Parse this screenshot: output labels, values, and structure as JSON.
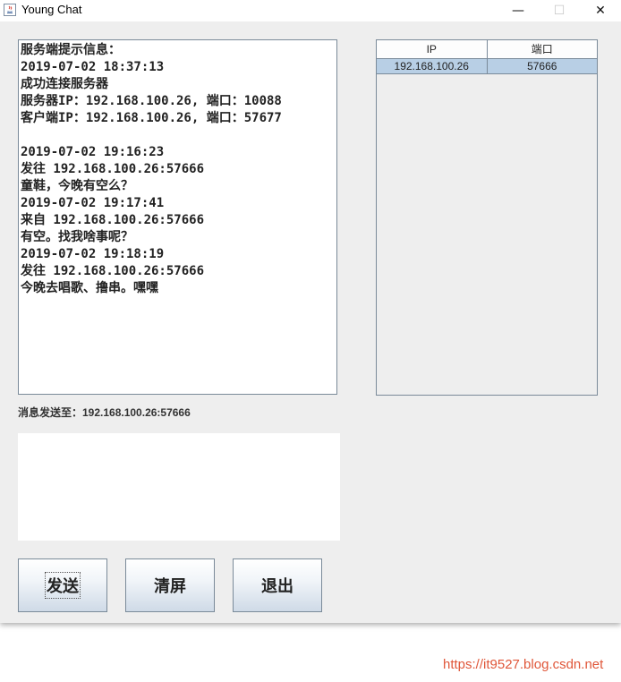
{
  "window": {
    "title": "Young Chat",
    "minimize_glyph": "—",
    "maximize_glyph": "☐",
    "close_glyph": "✕",
    "icon": "java-cup-icon"
  },
  "chat": {
    "lines": [
      "服务端提示信息：",
      "2019-07-02 18:37:13",
      "成功连接服务器",
      "服务器IP：192.168.100.26, 端口：10088",
      "客户端IP：192.168.100.26, 端口：57677",
      "",
      "2019-07-02 19:16:23",
      "发往 192.168.100.26:57666",
      "童鞋，今晚有空么？",
      "2019-07-02 19:17:41",
      "来自 192.168.100.26:57666",
      "有空。找我啥事呢？",
      "2019-07-02 19:18:19",
      "发往 192.168.100.26:57666",
      "今晚去唱歌、撸串。嘿嘿"
    ]
  },
  "table": {
    "columns": [
      "IP",
      "端口"
    ],
    "rows": [
      [
        "192.168.100.26",
        "57666"
      ]
    ],
    "selected_row_color": "#b8cfe5"
  },
  "send_to": "消息发送至：192.168.100.26:57666",
  "input": {
    "value": ""
  },
  "buttons": {
    "send": "发送",
    "clear": "清屏",
    "exit": "退出"
  },
  "watermark": "https://it9527.blog.csdn.net"
}
